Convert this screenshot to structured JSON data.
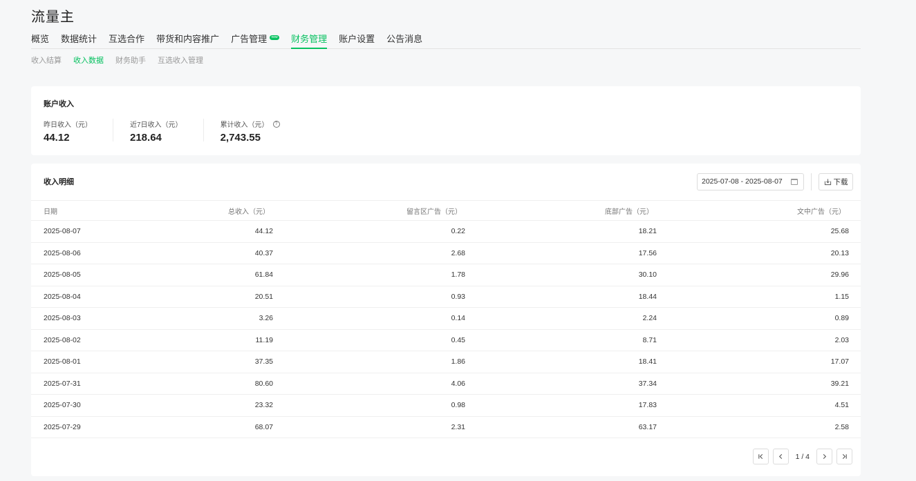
{
  "app": {
    "title": "流量主"
  },
  "main_tabs": [
    {
      "label": "概览"
    },
    {
      "label": "数据统计"
    },
    {
      "label": "互选合作"
    },
    {
      "label": "带货和内容推广"
    },
    {
      "label": "广告管理",
      "badge": "new"
    },
    {
      "label": "财务管理",
      "active": true
    },
    {
      "label": "账户设置"
    },
    {
      "label": "公告消息"
    }
  ],
  "sub_tabs": [
    {
      "label": "收入结算"
    },
    {
      "label": "收入数据",
      "active": true
    },
    {
      "label": "财务助手"
    },
    {
      "label": "互选收入管理"
    }
  ],
  "summary": {
    "title": "账户收入",
    "stats": [
      {
        "label": "昨日收入（元）",
        "value": "44.12"
      },
      {
        "label": "近7日收入（元）",
        "value": "218.64"
      },
      {
        "label": "累计收入（元）",
        "value": "2,743.55",
        "help": "?"
      }
    ]
  },
  "detail": {
    "title": "收入明细",
    "date_range": "2025-07-08 - 2025-08-07",
    "download_label": "下载",
    "columns": [
      "日期",
      "总收入（元）",
      "留言区广告（元）",
      "底部广告（元）",
      "文中广告（元）"
    ],
    "rows": [
      [
        "2025-08-07",
        "44.12",
        "0.22",
        "18.21",
        "25.68"
      ],
      [
        "2025-08-06",
        "40.37",
        "2.68",
        "17.56",
        "20.13"
      ],
      [
        "2025-08-05",
        "61.84",
        "1.78",
        "30.10",
        "29.96"
      ],
      [
        "2025-08-04",
        "20.51",
        "0.93",
        "18.44",
        "1.15"
      ],
      [
        "2025-08-03",
        "3.26",
        "0.14",
        "2.24",
        "0.89"
      ],
      [
        "2025-08-02",
        "11.19",
        "0.45",
        "8.71",
        "2.03"
      ],
      [
        "2025-08-01",
        "37.35",
        "1.86",
        "18.41",
        "17.07"
      ],
      [
        "2025-07-31",
        "80.60",
        "4.06",
        "37.34",
        "39.21"
      ],
      [
        "2025-07-30",
        "23.32",
        "0.98",
        "17.83",
        "4.51"
      ],
      [
        "2025-07-29",
        "68.07",
        "2.31",
        "63.17",
        "2.58"
      ]
    ],
    "pagination": {
      "text": "1 / 4"
    }
  },
  "colors": {
    "accent": "#07c160"
  }
}
